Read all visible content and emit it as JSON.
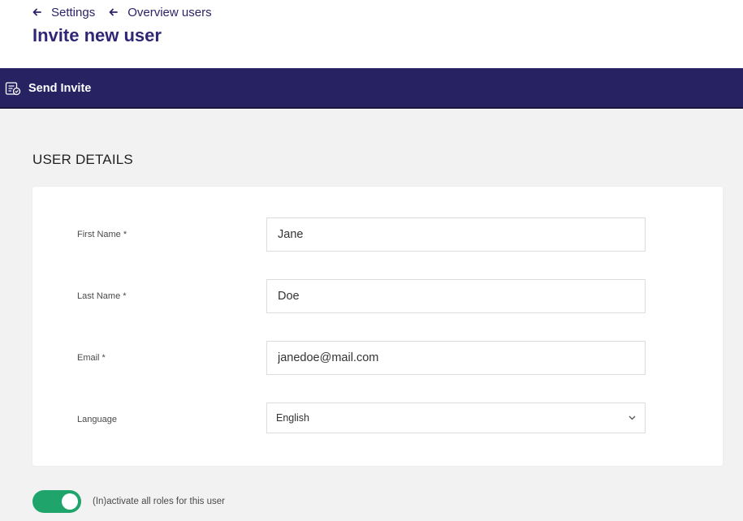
{
  "breadcrumbs": [
    {
      "label": "Settings"
    },
    {
      "label": "Overview users"
    }
  ],
  "page": {
    "title": "Invite new user"
  },
  "toolbar": {
    "send_invite_label": "Send Invite"
  },
  "section": {
    "title": "USER DETAILS"
  },
  "form": {
    "first_name": {
      "label": "First Name *",
      "value": "Jane"
    },
    "last_name": {
      "label": "Last Name *",
      "value": "Doe"
    },
    "email": {
      "label": "Email *",
      "value": "janedoe@mail.com"
    },
    "language": {
      "label": "Language",
      "value": "English"
    }
  },
  "toggle": {
    "label": "(In)activate all roles for this user",
    "on": true
  },
  "colors": {
    "primary": "#272262",
    "title": "#2f2775",
    "toggle_on": "#1fa56b",
    "background": "#f2f2f2"
  },
  "icons": {
    "back": "arrow-left-icon",
    "send": "invite-document-icon",
    "dropdown": "chevron-down-icon"
  }
}
